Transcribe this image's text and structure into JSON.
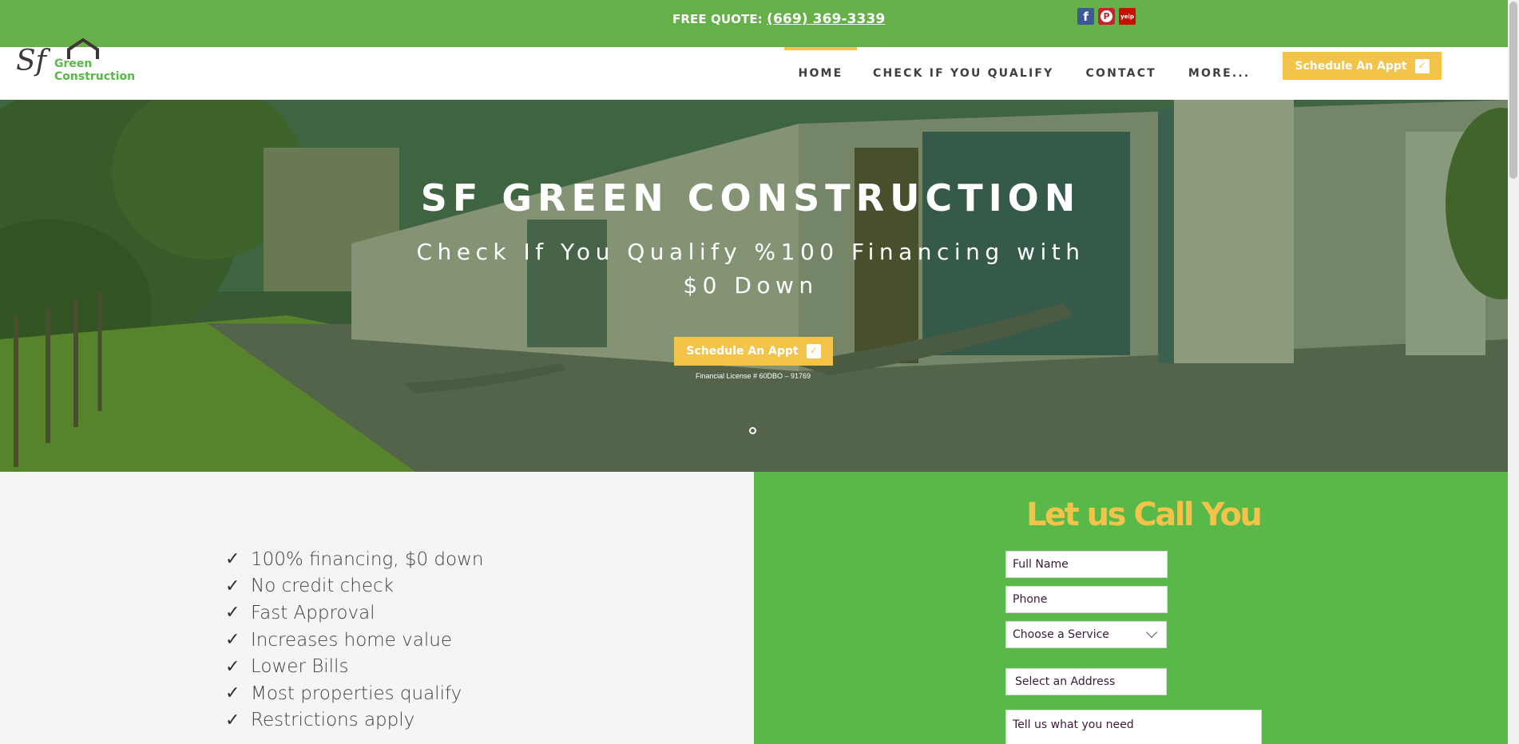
{
  "topbar": {
    "quote_label": "FREE QUOTE: ",
    "quote_phone": "(669) 369-3339",
    "social": [
      "facebook-icon",
      "pinterest-icon",
      "yelp-icon"
    ],
    "yelp_text": "yelp"
  },
  "logo": {
    "mark": "Sf",
    "line1": "Green",
    "line2": "Construction"
  },
  "nav": {
    "items": [
      "HOME",
      "CHECK IF YOU QUALIFY",
      "CONTACT",
      "MORE..."
    ],
    "active": "HOME",
    "cta": "Schedule An Appt"
  },
  "hero": {
    "title": "SF GREEN CONSTRUCTION",
    "subtitle": "Check If You Qualify %100 Financing with $0 Down",
    "cta": "Schedule An Appt",
    "license": "Financial License # 60DBO – 91769"
  },
  "benefits": [
    "100% financing, $0 down",
    "No credit check",
    "Fast Approval",
    "Increases home value",
    "Lower Bills",
    "Most properties qualify",
    "Restrictions apply"
  ],
  "form": {
    "title": "Let us Call You",
    "name_placeholder": "Full Name",
    "phone_placeholder": "Phone",
    "service_placeholder": "Choose a Service",
    "address_placeholder": "Select an Address",
    "needs_placeholder": "Tell us what you need"
  },
  "colors": {
    "topbar_green": "#66b04a",
    "form_green": "#58b948",
    "accent_yellow": "#f3c34a",
    "nav_text": "#3f3f3f"
  }
}
